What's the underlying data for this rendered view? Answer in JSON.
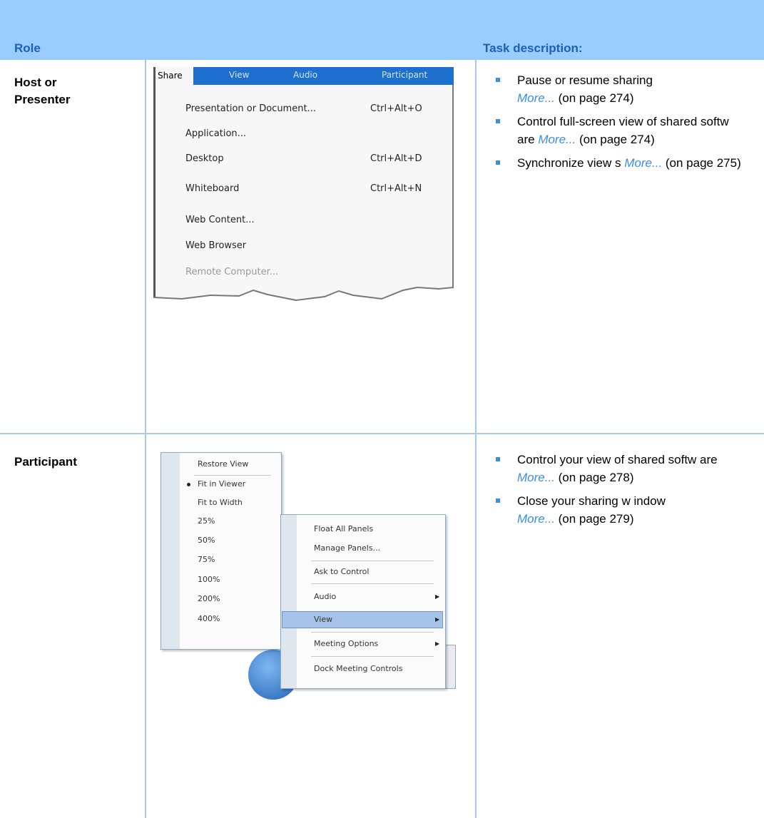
{
  "header": {
    "role": "Role",
    "task": "Task description:"
  },
  "rows": [
    {
      "role_line1": "Host or",
      "role_line2": "Presenter",
      "tasks": [
        {
          "text": "Pause or resume sharing",
          "more": "More...",
          "suffix": "(on page 274)"
        },
        {
          "text": "Control full-screen view of shared softw are",
          "more": "More...",
          "suffix": "(on page 274)"
        },
        {
          "text": "Synchronize view s",
          "more": "More...",
          "suffix": "(on page 275)"
        }
      ]
    },
    {
      "role_line1": "Participant",
      "tasks": [
        {
          "text": "Control your view of shared softw are",
          "more": "More...",
          "suffix": "(on page 278)"
        },
        {
          "text": "Close your sharing w indow",
          "more": "More...",
          "suffix": "(on page 279)"
        }
      ]
    }
  ],
  "share_menu": {
    "menubar": [
      "Share",
      "View",
      "Audio",
      "Participant"
    ],
    "items": [
      {
        "label": "Presentation or Document...",
        "shortcut": "Ctrl+Alt+O"
      },
      {
        "label": "Application...",
        "shortcut": ""
      },
      {
        "label": "Desktop",
        "shortcut": "Ctrl+Alt+D"
      },
      {
        "label": "Whiteboard",
        "shortcut": "Ctrl+Alt+N"
      },
      {
        "label": "Web Content...",
        "shortcut": ""
      },
      {
        "label": "Web Browser",
        "shortcut": ""
      },
      {
        "label": "Remote Computer...",
        "shortcut": ""
      }
    ]
  },
  "view_menu": {
    "items": [
      "Restore View",
      "Fit in Viewer",
      "Fit to Width",
      "25%",
      "50%",
      "75%",
      "100%",
      "200%",
      "400%"
    ],
    "selected": "Fit in Viewer"
  },
  "context_menu": {
    "items": [
      "Float All Panels",
      "Manage Panels...",
      "Ask to Control",
      "Audio",
      "View",
      "Meeting Options",
      "Dock Meeting Controls"
    ],
    "highlighted": "View"
  },
  "colors": {
    "header_band": "#99ccff",
    "header_text": "#1f5fb5",
    "link": "#3a8ee6",
    "grid": "#a9c8ec"
  }
}
